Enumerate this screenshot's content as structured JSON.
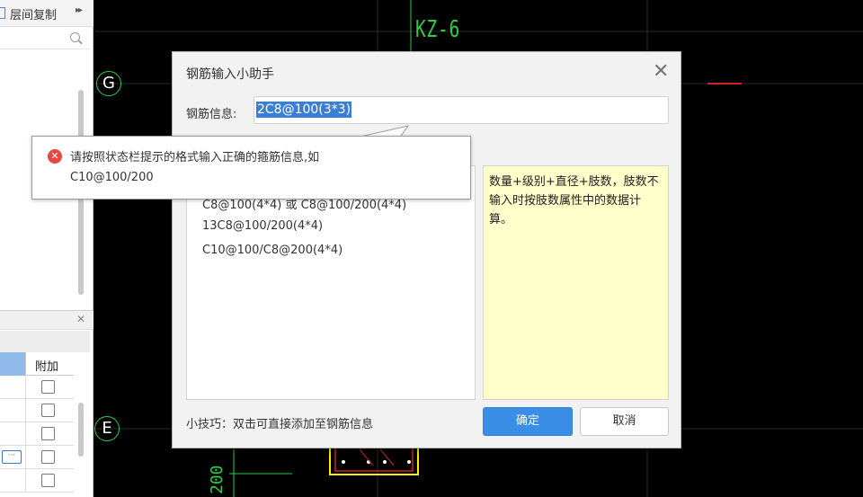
{
  "left_panel": {
    "floor_copy_label": "层间复制",
    "expand_icon": "double-chevron-right-icon",
    "search_icon": "search-icon",
    "close_icon": "close-icon",
    "table_header": "附加"
  },
  "cad": {
    "axis_g": "G",
    "axis_e": "E",
    "column_label": "KZ-6",
    "dimension_text": "200",
    "line_color": "#2ecc4a",
    "beam_color": "#cc2222"
  },
  "dialog": {
    "title": "钢筋输入小助手",
    "field_label": "钢筋信息:",
    "input_value": "2C8@100(3*3)",
    "list_items": [
      "C8@100(4*4) 或 C8@100/200(4*4)",
      "13C8@100/200(4*4)",
      "C10@100/C8@200(4*4)"
    ],
    "description": "数量+级别+直径+肢数，肢数不输入时按肢数属性中的数据计算。",
    "tip": "小技巧：双击可直接添加至钢筋信息",
    "ok_label": "确定",
    "cancel_label": "取消",
    "accent_color": "#3a8ee6"
  },
  "tooltip": {
    "line1": "请按照状态栏提示的格式输入正确的箍筋信息,如",
    "line2": "C10@100/200",
    "icon": "error-icon",
    "icon_color": "#e8473d"
  }
}
